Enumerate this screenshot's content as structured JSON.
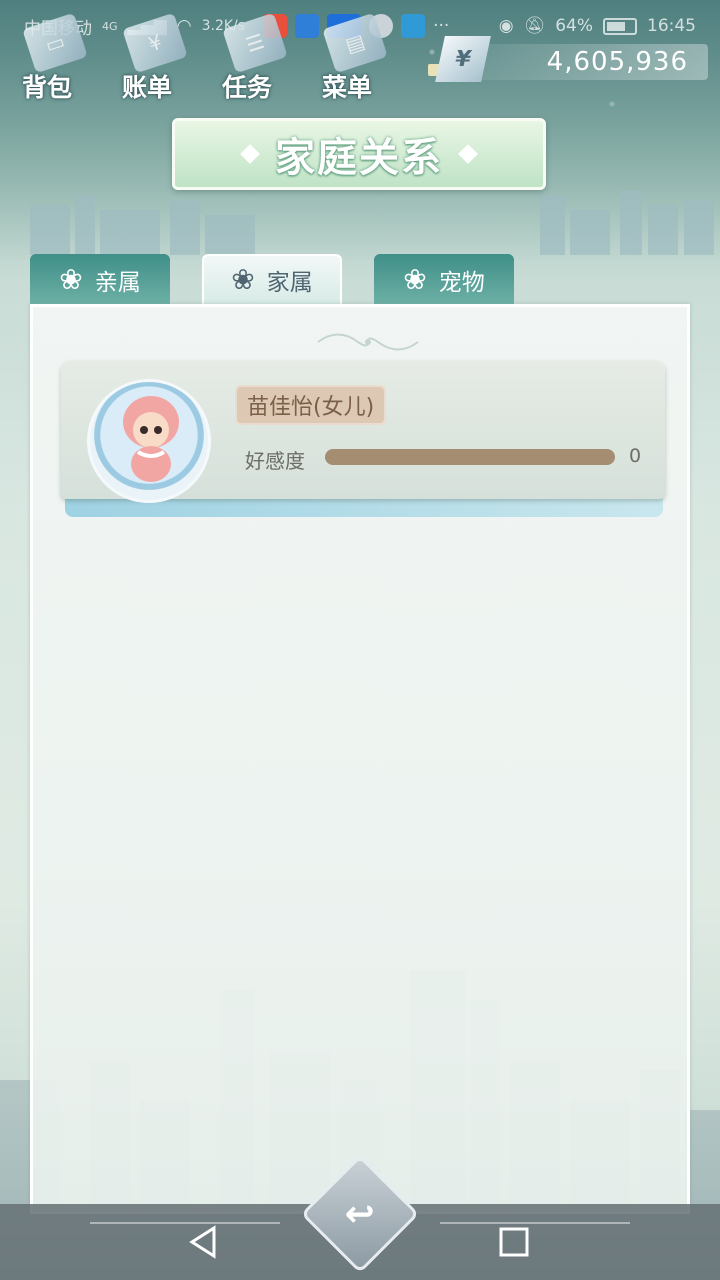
{
  "status_bar": {
    "carrier": "中国移动",
    "network": "4G",
    "speed": "3.2K/s",
    "battery": "64%",
    "time": "16:45"
  },
  "top_menu": [
    {
      "label": "背包",
      "icon": "backpack-icon"
    },
    {
      "label": "账单",
      "icon": "bill-icon"
    },
    {
      "label": "任务",
      "icon": "task-icon"
    },
    {
      "label": "菜单",
      "icon": "menu-icon"
    }
  ],
  "currency": {
    "symbol": "¥",
    "amount": "4,605,936"
  },
  "title": "家庭关系",
  "tabs": [
    {
      "label": "亲属",
      "active": false
    },
    {
      "label": "家属",
      "active": true
    },
    {
      "label": "宠物",
      "active": false
    }
  ],
  "family_members": [
    {
      "name": "苗佳怡(女儿)",
      "affection_label": "好感度",
      "affection_value": "0",
      "affection_level": 0
    }
  ],
  "colors": {
    "accent": "#6fb1a6",
    "title_green": "#bfe3c6",
    "affection_bar": "#a58d72"
  }
}
